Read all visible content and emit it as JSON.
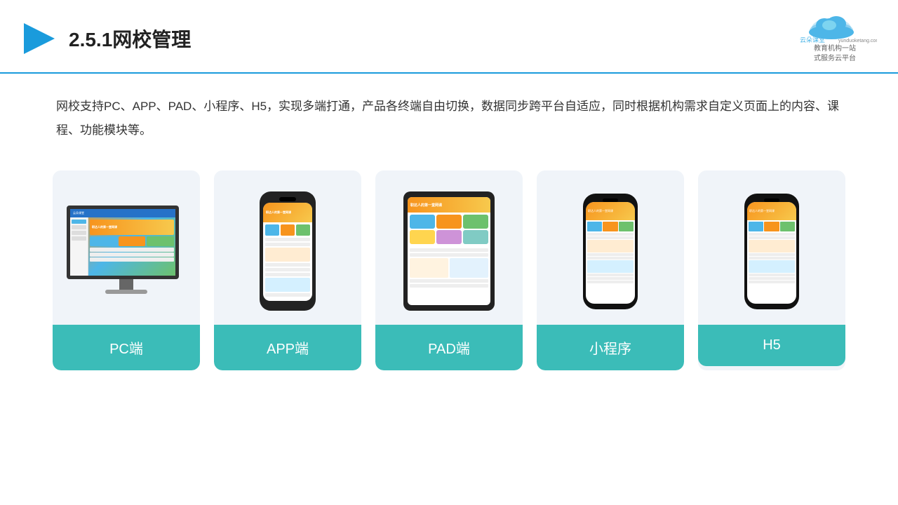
{
  "header": {
    "title": "2.5.1网校管理",
    "logo": {
      "name": "云朵课堂",
      "domain": "yunduoketang.com",
      "tagline": "教育机构一站",
      "tagline2": "式服务云平台"
    }
  },
  "description": {
    "text": "网校支持PC、APP、PAD、小程序、H5，实现多端打通，产品各终端自由切换，数据同步跨平台自适应，同时根据机构需求自定义页面上的内容、课程、功能模块等。"
  },
  "cards": [
    {
      "id": "pc",
      "label": "PC端"
    },
    {
      "id": "app",
      "label": "APP端"
    },
    {
      "id": "pad",
      "label": "PAD端"
    },
    {
      "id": "miniprogram",
      "label": "小程序"
    },
    {
      "id": "h5",
      "label": "H5"
    }
  ],
  "colors": {
    "accent": "#3bbcb8",
    "headerLine": "#1a9bdc",
    "titleColor": "#222222",
    "textColor": "#333333"
  }
}
